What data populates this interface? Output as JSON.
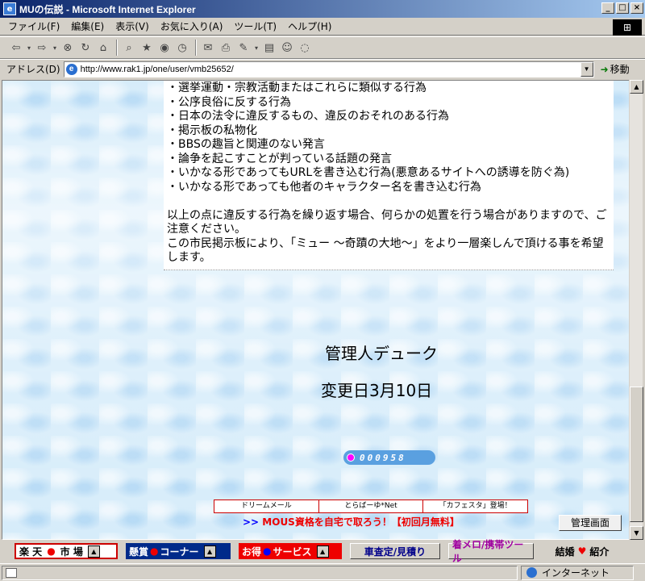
{
  "window": {
    "title": "MUの伝説 - Microsoft Internet Explorer"
  },
  "menu": [
    "ファイル(F)",
    "編集(E)",
    "表示(V)",
    "お気に入り(A)",
    "ツール(T)",
    "ヘルプ(H)"
  ],
  "address": {
    "label": "アドレス(D)",
    "url": "http://www.rak1.jp/one/user/vmb25652/",
    "go": "移動"
  },
  "content": {
    "rules": [
      "・選挙運動・宗教活動またはこれらに類似する行為",
      "・公序良俗に反する行為",
      "・日本の法令に違反するもの、違反のおそれのある行為",
      "・掲示板の私物化",
      "・BBSの趣旨と関連のない発言",
      "・論争を起こすことが判っている話題の発言",
      "・いかなる形であってもURLを書き込む行為(悪意あるサイトへの誘導を防ぐ為)",
      "・いかなる形であっても他者のキャラクター名を書き込む行為"
    ],
    "para1": "以上の点に違反する行為を繰り返す場合、何らかの処置を行う場合がありますので、ご注意ください。",
    "para2": "この市民掲示板により、「ミュー 〜奇蹟の大地〜」をより一層楽しんで頂ける事を希望します。"
  },
  "manager": "管理人デューク",
  "changed": "変更日3月10日",
  "counter": "000958",
  "links": [
    "ドリームメール",
    "とらばーゆ*Net",
    "「カフェスタ」登場！"
  ],
  "promo": {
    "chevrons": ">>",
    "text": "MOUS資格を自宅で取ろう！【初回月無料】"
  },
  "admin_button": "管理画面",
  "bottom": {
    "b1": {
      "a": "楽 天",
      "dot": "●",
      "b": "市 場"
    },
    "b2": {
      "a": "懸賞",
      "dot": "●",
      "b": "コーナー"
    },
    "b3": {
      "a": "お得",
      "dot": "●",
      "b": "サービス"
    },
    "b4": "車査定/見積り",
    "b5": "着メロ/携帯ツール",
    "b6": {
      "a": "結婚",
      "heart": "♥",
      "b": "紹介"
    }
  },
  "status": {
    "zone": "インターネット"
  }
}
